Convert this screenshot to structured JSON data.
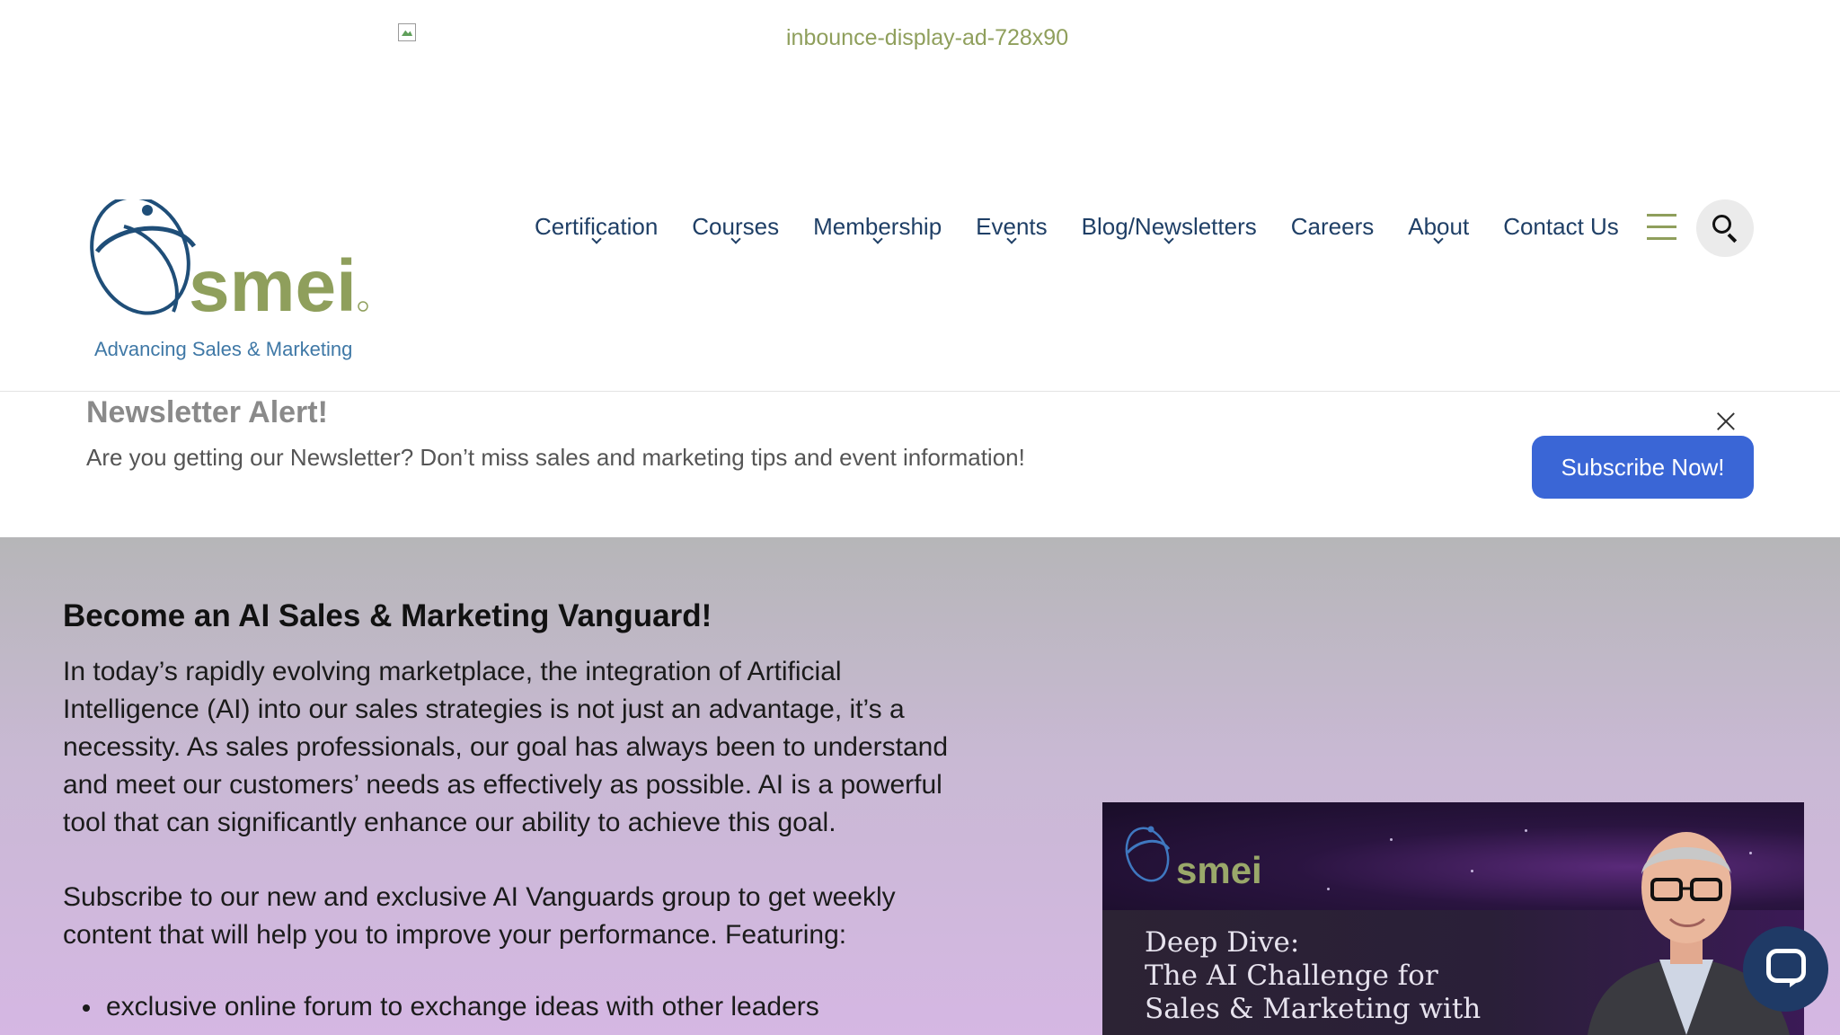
{
  "ad": {
    "alt_text": "inbounce-display-ad-728x90"
  },
  "header": {
    "logo_text": "smei",
    "tagline": "Advancing Sales & Marketing",
    "nav": [
      {
        "label": "Certification",
        "has_dropdown": true
      },
      {
        "label": "Courses",
        "has_dropdown": true
      },
      {
        "label": "Membership",
        "has_dropdown": true
      },
      {
        "label": "Events",
        "has_dropdown": true
      },
      {
        "label": "Blog/Newsletters",
        "has_dropdown": true
      },
      {
        "label": "Careers",
        "has_dropdown": false
      },
      {
        "label": "About",
        "has_dropdown": true
      },
      {
        "label": "Contact Us",
        "has_dropdown": false
      }
    ],
    "menu_icon": "hamburger-menu-icon",
    "search_icon": "search-icon"
  },
  "alert": {
    "title": "Newsletter Alert!",
    "text": "Are you getting our Newsletter? Don’t miss sales and marketing tips and event information!",
    "button": "Subscribe Now!",
    "close_icon": "close-icon"
  },
  "hero": {
    "heading": "Become an AI Sales & Marketing Vanguard!",
    "paragraph1": "In today’s rapidly evolving marketplace, the integration of Artificial Intelligence (AI) into our sales strategies is not just an advantage, it’s a necessity. As sales professionals, our goal has always been to understand and meet our customers’ needs as effectively as possible. AI is a powerful tool that can significantly enhance our ability to achieve this goal.",
    "paragraph2": "Subscribe to our new and exclusive AI Vanguards group to get weekly content that will help you to improve your performance. Featuring:",
    "list": [
      "exclusive online forum to exchange ideas with other leaders"
    ],
    "video": {
      "logo_text": "smei",
      "title": "Deep Dive:\nThe AI Challenge for\nSales & Marketing with"
    }
  },
  "chat": {
    "icon": "chat-icon"
  },
  "colors": {
    "brand_blue": "#1f3f66",
    "brand_olive": "#8f9f5c",
    "button_blue": "#3a66d6",
    "tagline_blue": "#3f78a6"
  }
}
